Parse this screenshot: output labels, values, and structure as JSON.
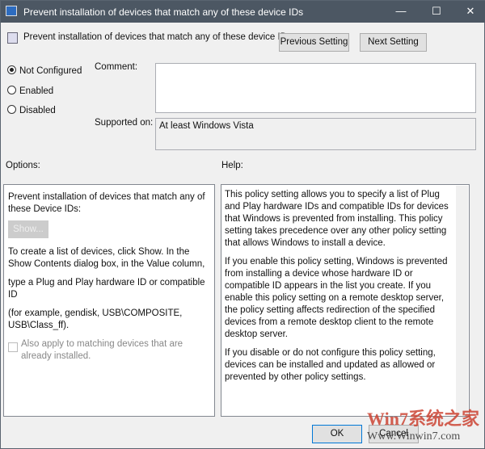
{
  "window": {
    "title": "Prevent installation of devices that match any of these device IDs",
    "minimize": "—",
    "maximize": "☐",
    "close": "✕"
  },
  "header": {
    "title": "Prevent installation of devices that match any of these device IDs",
    "previous": "Previous Setting",
    "next": "Next Setting"
  },
  "state": {
    "options": [
      "Not Configured",
      "Enabled",
      "Disabled"
    ],
    "selected": "Not Configured"
  },
  "comment_label": "Comment:",
  "supported_label": "Supported on:",
  "supported_value": "At least Windows Vista",
  "options_label": "Options:",
  "help_label": "Help:",
  "options_panel": {
    "intro": "Prevent installation of devices that match any of these Device IDs:",
    "show": "Show...",
    "p1": "To create a list of devices, click Show. In the Show Contents dialog box, in the Value column,",
    "p2": "type a Plug and Play hardware ID or compatible ID",
    "p3": "(for example, gendisk, USB\\COMPOSITE, USB\\Class_ff).",
    "checkbox": "Also apply to matching devices that are already installed."
  },
  "help_panel": {
    "p1": "This policy setting allows you to specify a list of Plug and Play hardware IDs and compatible IDs for devices that Windows is prevented from installing. This policy setting takes precedence over any other policy setting that allows Windows to install a device.",
    "p2": "If you enable this policy setting, Windows is prevented from installing a device whose hardware ID or compatible ID appears in the list you create. If you enable this policy setting on a remote desktop server, the policy setting affects redirection of the specified devices from a remote desktop client to the remote desktop server.",
    "p3": "If you disable or do not configure this policy setting, devices can be installed and updated as allowed or prevented by other policy settings."
  },
  "footer": {
    "ok": "OK",
    "cancel": "Cancel"
  },
  "watermark": {
    "brand": "Win7系统之家",
    "url": "Www.Winwin7.com"
  }
}
